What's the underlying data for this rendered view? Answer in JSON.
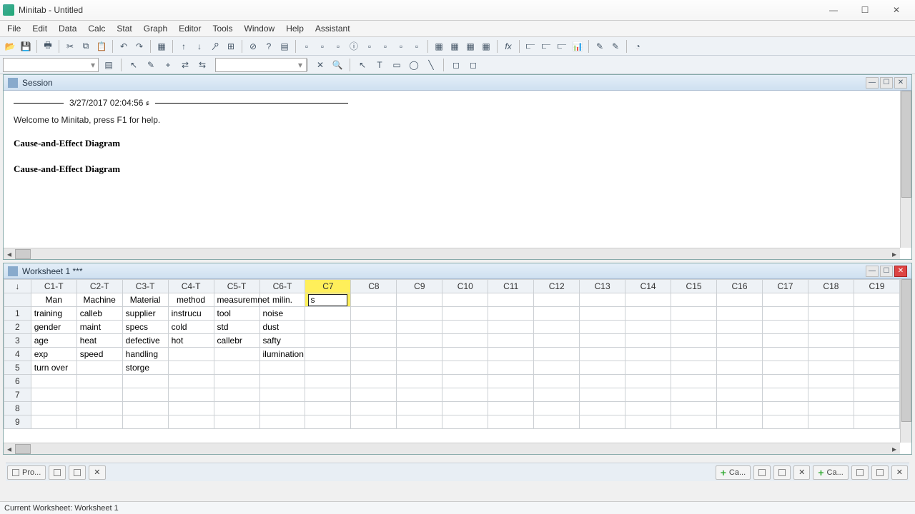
{
  "app": {
    "title": "Minitab - Untitled"
  },
  "menu": [
    "File",
    "Edit",
    "Data",
    "Calc",
    "Stat",
    "Graph",
    "Editor",
    "Tools",
    "Window",
    "Help",
    "Assistant"
  ],
  "session": {
    "title": "Session",
    "timestamp": "3/27/2017 02:04:56 ‫ء",
    "welcome": "Welcome to Minitab, press F1 for help.",
    "heading1": "Cause-and-Effect Diagram",
    "heading2": "Cause-and-Effect Diagram"
  },
  "worksheet": {
    "title": "Worksheet 1 ***",
    "columns": [
      "C1-T",
      "C2-T",
      "C3-T",
      "C4-T",
      "C5-T",
      "C6-T",
      "C7",
      "C8",
      "C9",
      "C10",
      "C11",
      "C12",
      "C13",
      "C14",
      "C15",
      "C16",
      "C17",
      "C18",
      "C19"
    ],
    "names": [
      "Man",
      "Machine",
      "Material",
      "method",
      "measuremnet",
      "milin.",
      "",
      "",
      "",
      "",
      "",
      "",
      "",
      "",
      "",
      "",
      "",
      "",
      ""
    ],
    "active_input": "s",
    "rows": [
      [
        "training",
        "calleb",
        "supplier",
        "instrucu",
        "tool",
        "noise",
        "",
        "",
        "",
        "",
        "",
        "",
        "",
        "",
        "",
        "",
        "",
        "",
        ""
      ],
      [
        "gender",
        "maint",
        "specs",
        "cold",
        "std",
        "dust",
        "",
        "",
        "",
        "",
        "",
        "",
        "",
        "",
        "",
        "",
        "",
        "",
        ""
      ],
      [
        "age",
        "heat",
        "defective",
        "hot",
        "callebr",
        "safty",
        "",
        "",
        "",
        "",
        "",
        "",
        "",
        "",
        "",
        "",
        "",
        "",
        ""
      ],
      [
        "exp",
        "speed",
        "handling",
        "",
        "",
        "ilumination",
        "",
        "",
        "",
        "",
        "",
        "",
        "",
        "",
        "",
        "",
        "",
        "",
        ""
      ],
      [
        "turn over",
        "",
        "storge",
        "",
        "",
        "",
        "",
        "",
        "",
        "",
        "",
        "",
        "",
        "",
        "",
        "",
        "",
        "",
        ""
      ],
      [
        "",
        "",
        "",
        "",
        "",
        "",
        "",
        "",
        "",
        "",
        "",
        "",
        "",
        "",
        "",
        "",
        "",
        "",
        ""
      ],
      [
        "",
        "",
        "",
        "",
        "",
        "",
        "",
        "",
        "",
        "",
        "",
        "",
        "",
        "",
        "",
        "",
        "",
        "",
        ""
      ],
      [
        "",
        "",
        "",
        "",
        "",
        "",
        "",
        "",
        "",
        "",
        "",
        "",
        "",
        "",
        "",
        "",
        "",
        "",
        ""
      ],
      [
        "",
        "",
        "",
        "",
        "",
        "",
        "",
        "",
        "",
        "",
        "",
        "",
        "",
        "",
        "",
        "",
        "",
        "",
        ""
      ]
    ]
  },
  "tabs": {
    "pro": "Pro...",
    "ca1": "Ca...",
    "ca2": "Ca..."
  },
  "status": "Current Worksheet: Worksheet 1"
}
